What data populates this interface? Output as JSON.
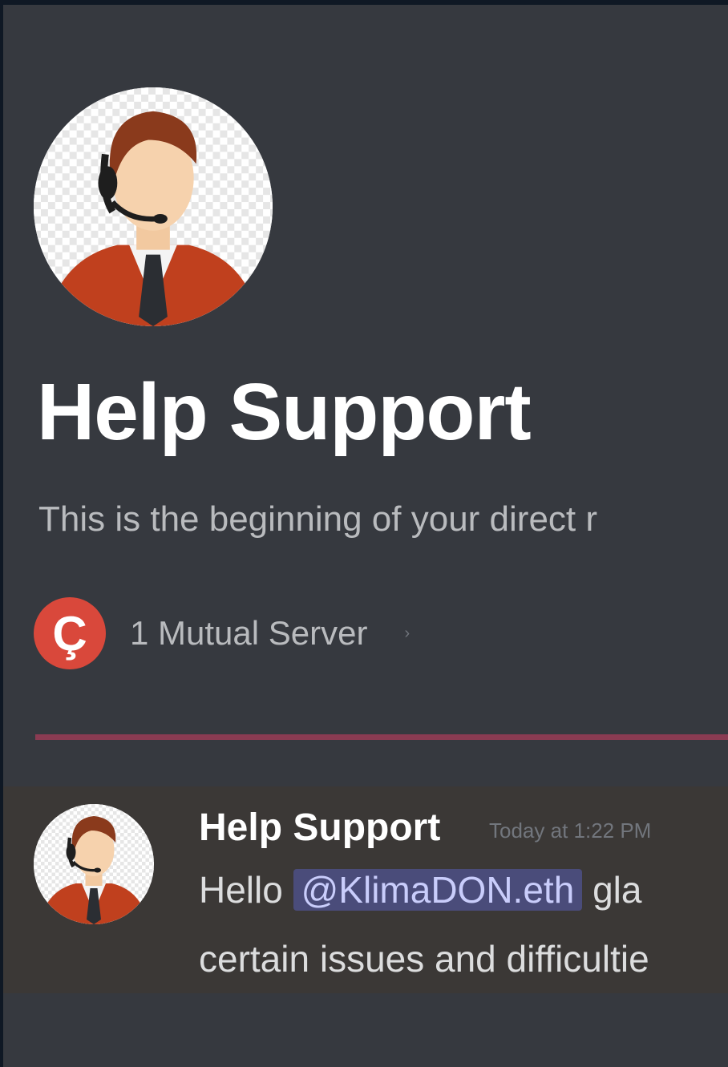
{
  "header": {
    "title": "Help Support",
    "subtitle": "This is the beginning of your direct r",
    "avatar_icon": "support-agent-headset-avatar"
  },
  "mutual_servers": {
    "icon_letter": "Ç",
    "label": "1 Mutual Server",
    "chevron": "›"
  },
  "message": {
    "author": "Help Support",
    "timestamp": "Today at 1:22 PM",
    "greeting": "Hello",
    "mention": "@KlimaDON.eth",
    "text_after_mention": "gla",
    "line2": "certain issues and difficultie"
  },
  "colors": {
    "background": "#36393f",
    "divider": "#8a3b52",
    "mention_bg": "#4a4c7a",
    "server_icon": "#d9483b"
  }
}
